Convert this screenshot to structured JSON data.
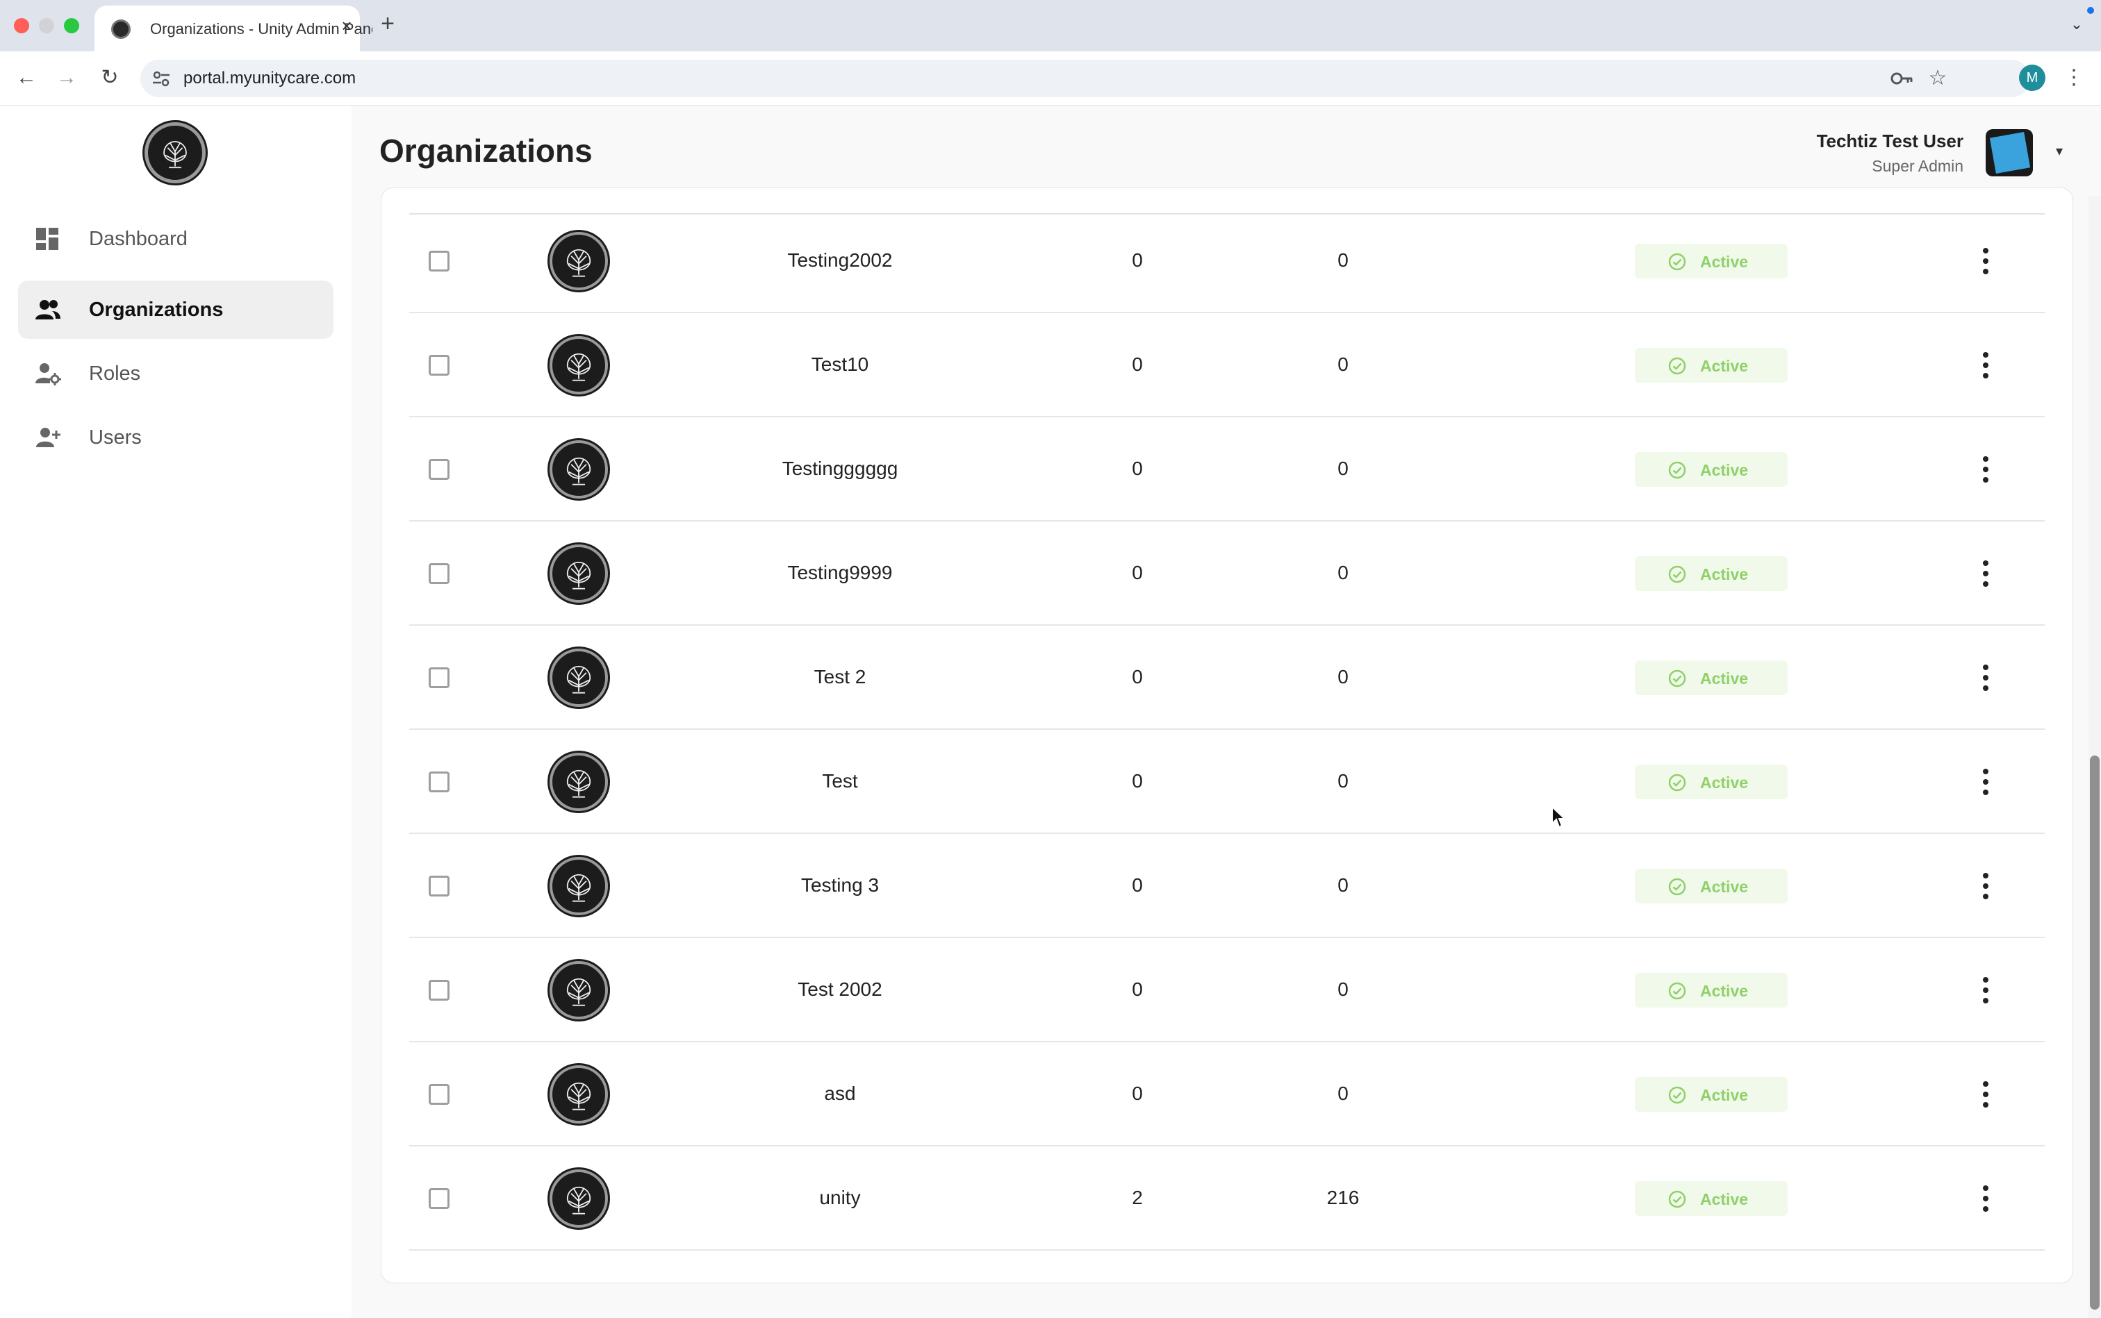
{
  "browser": {
    "tab_title": "Organizations - Unity Admin Panel",
    "tab_close": "×",
    "new_tab": "+",
    "tabs_menu": "⌄",
    "url": "portal.myunitycare.com",
    "profile_initial": "M",
    "menu": "⋮",
    "back": "←",
    "forward": "→",
    "reload": "↻",
    "star": "☆",
    "traffic_colors": [
      "#ff5f57",
      "#d0d2d6",
      "#28c840"
    ]
  },
  "sidebar": {
    "items": [
      {
        "label": "Dashboard",
        "icon": "dashboard-icon",
        "active": false
      },
      {
        "label": "Organizations",
        "icon": "organizations-icon",
        "active": true
      },
      {
        "label": "Roles",
        "icon": "roles-icon",
        "active": false
      },
      {
        "label": "Users",
        "icon": "users-icon",
        "active": false
      }
    ]
  },
  "header": {
    "title": "Organizations",
    "user_name": "Techtiz Test User",
    "user_role": "Super Admin",
    "caret": "▾"
  },
  "table": {
    "status_color": "#8fd06a",
    "rows": [
      {
        "name": "Testing2002",
        "count1": "0",
        "count2": "0",
        "status": "Active"
      },
      {
        "name": "Test10",
        "count1": "0",
        "count2": "0",
        "status": "Active"
      },
      {
        "name": "Testingggggg",
        "count1": "0",
        "count2": "0",
        "status": "Active"
      },
      {
        "name": "Testing9999",
        "count1": "0",
        "count2": "0",
        "status": "Active"
      },
      {
        "name": "Test 2",
        "count1": "0",
        "count2": "0",
        "status": "Active"
      },
      {
        "name": "Test",
        "count1": "0",
        "count2": "0",
        "status": "Active"
      },
      {
        "name": "Testing 3",
        "count1": "0",
        "count2": "0",
        "status": "Active"
      },
      {
        "name": "Test 2002",
        "count1": "0",
        "count2": "0",
        "status": "Active"
      },
      {
        "name": "asd",
        "count1": "0",
        "count2": "0",
        "status": "Active"
      },
      {
        "name": "unity",
        "count1": "2",
        "count2": "216",
        "status": "Active"
      }
    ]
  }
}
